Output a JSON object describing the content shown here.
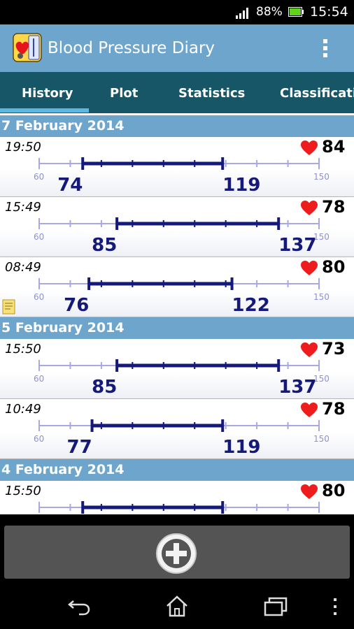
{
  "status_bar": {
    "battery_percent": "88%",
    "time": "15:54"
  },
  "app": {
    "title": "Blood Pressure Diary"
  },
  "tabs": [
    {
      "label": "History",
      "selected": true
    },
    {
      "label": "Plot",
      "selected": false
    },
    {
      "label": "Statistics",
      "selected": false
    },
    {
      "label": "Classification",
      "selected": false
    }
  ],
  "scale": {
    "min_label": "60",
    "max_label": "150",
    "min": 60,
    "max": 150
  },
  "groups": [
    {
      "date": "7 February 2014",
      "entries": [
        {
          "time": "19:50",
          "pulse": "84",
          "diastolic": "74",
          "systolic": "119",
          "has_note": false
        },
        {
          "time": "15:49",
          "pulse": "78",
          "diastolic": "85",
          "systolic": "137",
          "has_note": false
        },
        {
          "time": "08:49",
          "pulse": "80",
          "diastolic": "76",
          "systolic": "122",
          "has_note": true
        }
      ]
    },
    {
      "date": "5 February 2014",
      "entries": [
        {
          "time": "15:50",
          "pulse": "73",
          "diastolic": "85",
          "systolic": "137",
          "has_note": false
        },
        {
          "time": "10:49",
          "pulse": "78",
          "diastolic": "77",
          "systolic": "119",
          "has_note": false
        }
      ]
    },
    {
      "date": "4 February 2014",
      "entries": [
        {
          "time": "15:50",
          "pulse": "80",
          "diastolic": "74",
          "systolic": "119",
          "has_note": false
        }
      ]
    }
  ],
  "icons": {
    "signal": "signal-icon",
    "battery": "battery-icon",
    "app": "app-logo-icon",
    "overflow": "overflow-menu-icon",
    "heart": "heart-icon",
    "note": "note-icon",
    "add": "add-icon",
    "back": "back-icon",
    "home": "home-icon",
    "recent": "recent-apps-icon",
    "menu": "menu-icon"
  },
  "colors": {
    "action_bar": "#6ea5cc",
    "tab_bar": "#165667",
    "tab_indicator": "#5fb6e0",
    "bp_line": "#14197a",
    "scale_line": "#a7a9e6",
    "heart": "#ee1c1c"
  }
}
